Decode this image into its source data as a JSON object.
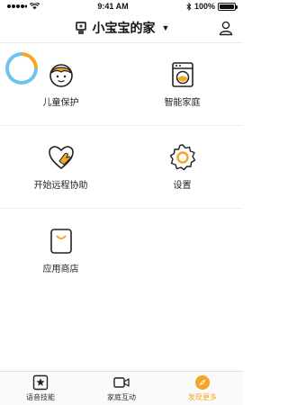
{
  "status_bar": {
    "time": "9:41 AM",
    "battery": "100%",
    "battery_level": 1.0
  },
  "header": {
    "title": "小宝宝的家"
  },
  "grid": [
    {
      "label": "儿童保护",
      "icon": "child-face-icon"
    },
    {
      "label": "智能家庭",
      "icon": "washing-machine-icon"
    },
    {
      "label": "开始远程协助",
      "icon": "heart-hand-icon"
    },
    {
      "label": "设置",
      "icon": "gear-icon"
    },
    {
      "label": "应用商店",
      "icon": "shopping-bag-icon"
    }
  ],
  "tab_bar": {
    "items": [
      {
        "label": "语音技能",
        "icon": "star-square-icon",
        "active": false
      },
      {
        "label": "家庭互动",
        "icon": "video-camera-icon",
        "active": false
      },
      {
        "label": "发现更多",
        "icon": "compass-icon",
        "active": true
      }
    ]
  },
  "colors": {
    "accent": "#f5a623",
    "ring_blue": "#6fc3ef"
  }
}
